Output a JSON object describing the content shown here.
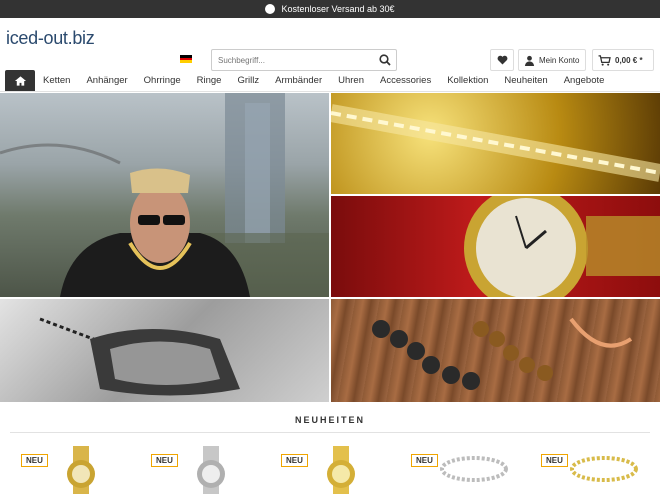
{
  "topbar": {
    "text": "Kostenloser Versand ab 30€",
    "icon": "percent-badge-icon"
  },
  "header": {
    "logo": "iced-out.biz",
    "search_placeholder": "Suchbegriff...",
    "account_label": "Mein Konto",
    "cart_label": "0,00 € *"
  },
  "nav": {
    "items": [
      "Ketten",
      "Anhänger",
      "Ohrringe",
      "Ringe",
      "Grillz",
      "Armbänder",
      "Uhren",
      "Accessories",
      "Kollektion",
      "Neuheiten",
      "Angebote"
    ]
  },
  "section": {
    "title": "NEUHEITEN"
  },
  "products": [
    {
      "badge": "NEU",
      "kind": "watch-gold"
    },
    {
      "badge": "NEU",
      "kind": "watch-silver"
    },
    {
      "badge": "NEU",
      "kind": "watch-gold-2"
    },
    {
      "badge": "NEU",
      "kind": "tennis-bracelet-silver"
    },
    {
      "badge": "NEU",
      "kind": "tennis-bracelet-gold"
    }
  ],
  "colors": {
    "topbar": "#333333",
    "logo": "#2b4a6e",
    "badge_border": "#f0a500"
  }
}
